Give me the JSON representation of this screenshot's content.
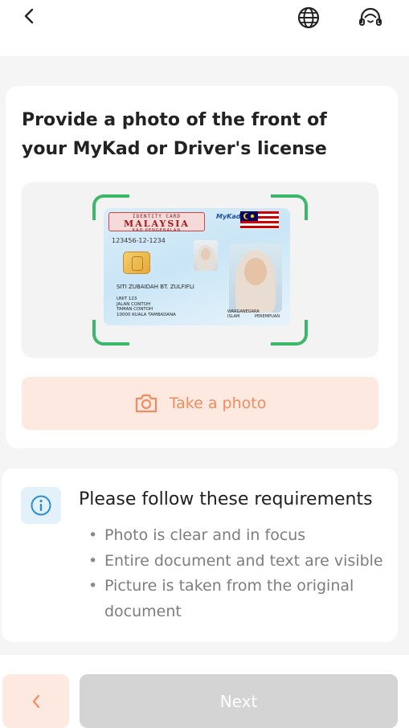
{
  "header": {
    "back_icon": "chevron-left-icon",
    "language_icon": "globe-icon",
    "support_icon": "headset-icon"
  },
  "upload_card": {
    "title": "Provide a photo of the front of your MyKad or Driver's license",
    "sample_card": {
      "banner_line1": "IDENTITY CARD",
      "banner_line2": "MALAYSIA",
      "banner_line3": "KAD PENGENALAN",
      "brand": "MyKad",
      "id_number": "123456-12-1234",
      "holder_name": "SITI ZUBAIDAH BT. ZULFIFLI",
      "address_lines": [
        "UNIT 123",
        "JALAN CONTOH",
        "TAMAN CONTOH",
        "10000 KUALA TAMBADANA"
      ],
      "citizenship": "WARGANEGARA",
      "religion": "ISLAM",
      "gender": "PEREMPUAN"
    },
    "take_photo_label": "Take a photo",
    "camera_icon": "camera-icon"
  },
  "requirements": {
    "icon": "info-icon",
    "title": "Please follow these requirements",
    "items": [
      "Photo is clear and in focus",
      "Entire document and text are visible",
      "Picture is taken from the original document"
    ]
  },
  "footer": {
    "prev_icon": "chevron-left-icon",
    "next_label": "Next"
  },
  "colors": {
    "accent": "#f28c60",
    "accent_bg": "#fde9df",
    "frame_green": "#3cb86b",
    "disabled": "#d4d4d4"
  }
}
